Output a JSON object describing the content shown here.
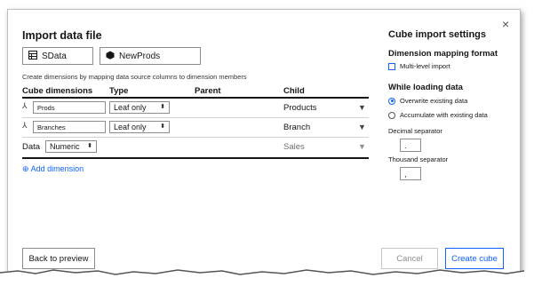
{
  "dialog": {
    "title": "Import data file",
    "close": "×"
  },
  "source": {
    "sheet_name": "SData",
    "cube_name": "NewProds"
  },
  "hint": "Create dimensions by mapping data source columns to dimension members",
  "table": {
    "headers": {
      "dimensions": "Cube dimensions",
      "type": "Type",
      "parent": "Parent",
      "child": "Child"
    },
    "rows": [
      {
        "name": "Prods",
        "type": "Leaf only",
        "child": "Products"
      },
      {
        "name": "Branches",
        "type": "Leaf only",
        "child": "Branch"
      }
    ],
    "data_row": {
      "label": "Data",
      "type": "Numeric",
      "child": "Sales"
    }
  },
  "add_dimension": "Add dimension",
  "settings": {
    "title": "Cube import settings",
    "mapping_title": "Dimension mapping format",
    "multi_level": "Multi-level import",
    "loading_title": "While loading data",
    "overwrite": "Overwrite existing data",
    "accumulate": "Accumulate with existing data",
    "decimal_label": "Decimal separator",
    "decimal_value": ".",
    "thousand_label": "Thousand separator",
    "thousand_value": ","
  },
  "buttons": {
    "back": "Back to preview",
    "cancel": "Cancel",
    "create": "Create cube"
  },
  "colors": {
    "accent": "#0f62fe",
    "text": "#161616",
    "border": "#8d8d8d"
  }
}
